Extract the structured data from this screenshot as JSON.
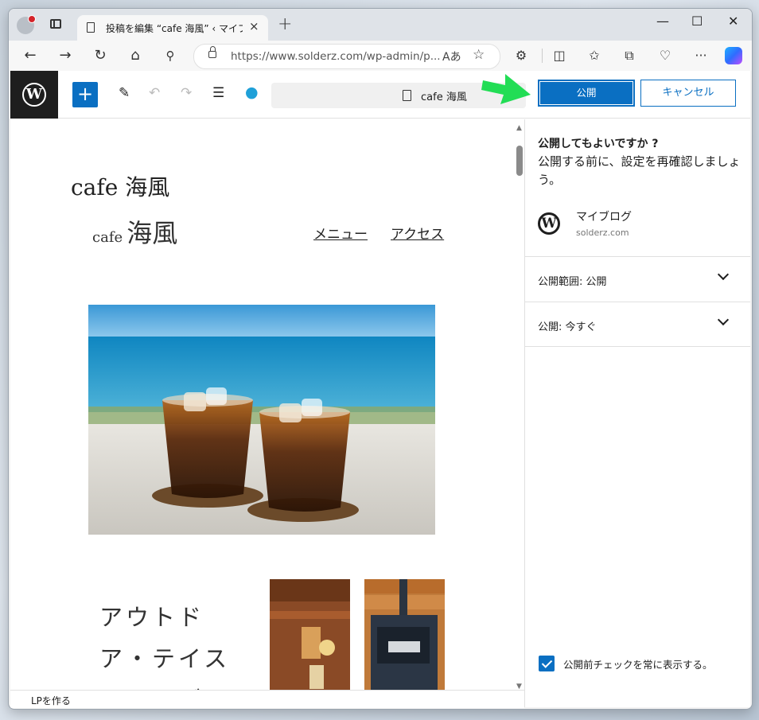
{
  "browser": {
    "tab_title": "投稿を編集 “cafe 海風” ‹ マイブログ",
    "tab_close": "×",
    "new_tab": "+",
    "url_domain": "https://www.solderz.com",
    "url_path": "/wp-admin/p...",
    "read_aloud": "Aあ",
    "window_controls": {
      "minimize": "—",
      "maximize": "☐",
      "close": "✕"
    }
  },
  "editor": {
    "add_block": "+",
    "document_title": "cafe 海風",
    "publish_button": "公開",
    "cancel_button": "キャンセル"
  },
  "canvas": {
    "post_title": "cafe 海風",
    "site_logo_small": "cafe",
    "site_logo_big": "海風",
    "nav": [
      "メニュー",
      "アクセス"
    ],
    "side_heading": "アウトドア・テイストのログハ"
  },
  "statusbar": {
    "breadcrumb": "LPを作る"
  },
  "sidebar": {
    "question": "公開してもよいですか ?",
    "description": "公開する前に、設定を再確認しましょう。",
    "site_name": "マイブログ",
    "site_url": "solderz.com",
    "visibility": "公開範囲: 公開",
    "publish_time": "公開: 今すぐ",
    "always_show_label": "公開前チェックを常に表示する。",
    "always_show_checked": true
  },
  "colors": {
    "accent": "#0a6fc2",
    "arrow": "#22dd55"
  }
}
